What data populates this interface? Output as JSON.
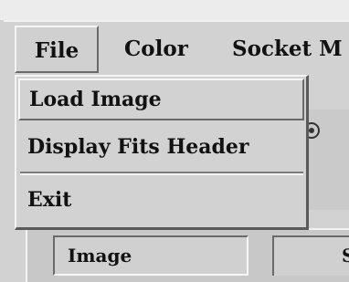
{
  "menubar": {
    "items": [
      {
        "label": "File"
      },
      {
        "label": "Color"
      },
      {
        "label": "Socket M"
      }
    ]
  },
  "file_menu": {
    "items": [
      {
        "label": "Load Image"
      },
      {
        "label": "Display Fits Header"
      },
      {
        "label": "Exit"
      }
    ]
  },
  "panel": {
    "image_label": "Image",
    "second_label": "S"
  },
  "icons": {
    "toolbar_icon": "tool-icon"
  }
}
